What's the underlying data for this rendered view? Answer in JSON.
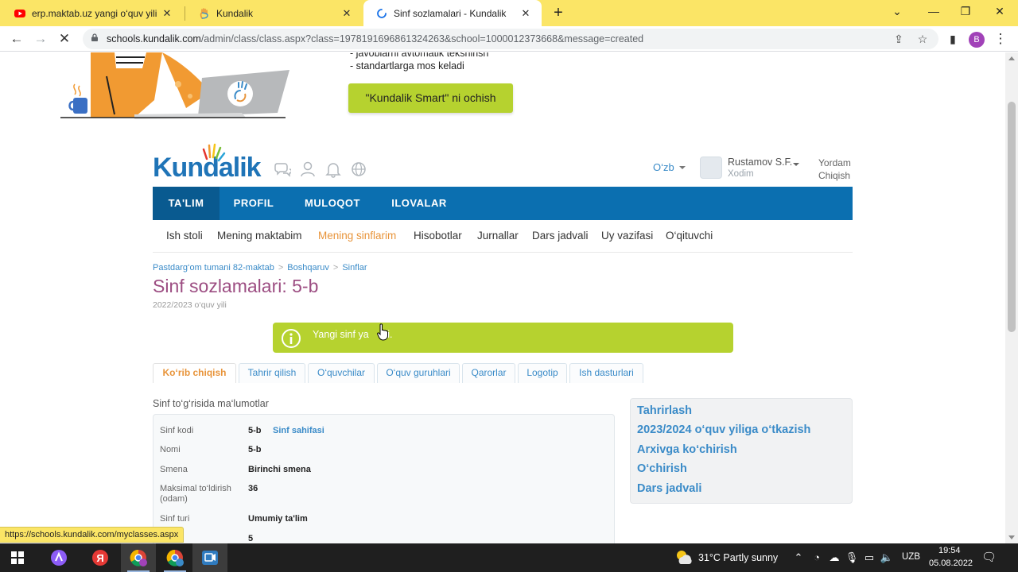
{
  "browser": {
    "tabs": [
      {
        "title": "erp.maktab.uz yangi o‘quv yili o‘t",
        "icon": "youtube-icon"
      },
      {
        "title": "Kundalik",
        "icon": "kundalik-hand-icon"
      },
      {
        "title": "Sinf sozlamalari - Kundalik",
        "icon": "loading-spinner-icon"
      }
    ],
    "url_host": "schools.kundalik.com",
    "url_rest": "/admin/class/class.aspx?class=1978191696861324263&school=1000012373668&message=created",
    "profile_initial": "B",
    "status_url": "https://schools.kundalik.com/myclasses.aspx"
  },
  "banner": {
    "lines": [
      "- javoblarni avtomatik tekshirish",
      "- standartlarga mos keladi"
    ],
    "button": "\"Kundalik Smart\" ni ochish"
  },
  "header": {
    "language": "O‘zb",
    "user_name": "Rustamov S.F.",
    "user_role": "Xodim",
    "help": "Yordam",
    "logout": "Chiqish"
  },
  "main_nav": [
    "TA'LIM",
    "PROFIL",
    "MULOQOT",
    "ILOVALAR"
  ],
  "sub_nav": [
    "Ish stoli",
    "Mening maktabim",
    "Mening sinflarim",
    "Hisobotlar",
    "Jurnallar",
    "Dars jadvali",
    "Uy vazifasi",
    "O‘qituvchi"
  ],
  "breadcrumbs": [
    "Pastdarg‘om tumani 82-maktab",
    "Boshqaruv",
    "Sinflar"
  ],
  "page": {
    "title": "Sinf sozlamalari: 5-b",
    "subtitle": "2022/2023 o‘quv yili",
    "alert": "Yangi sinf yaratildi.",
    "alert_visible": "Yangi sinf ya    ldi."
  },
  "content_tabs": [
    "Ko‘rib chiqish",
    "Tahrir qilish",
    "O‘quvchilar",
    "O‘quv guruhlari",
    "Qarorlar",
    "Logotip",
    "Ish dasturlari"
  ],
  "info": {
    "section_label": "Sinf to‘g‘risida ma‘lumotlar",
    "rows": [
      {
        "label": "Sinf kodi",
        "value": "5-b",
        "link": "Sinf sahifasi"
      },
      {
        "label": "Nomi",
        "value": "5-b"
      },
      {
        "label": "Smena",
        "value": "Birinchi smena"
      },
      {
        "label": "Maksimal to‘ldirish (odam)",
        "value": "36"
      },
      {
        "label": "Sinf turi",
        "value": "Umumiy ta'lim"
      },
      {
        "label": "el",
        "value": "5"
      }
    ]
  },
  "side_actions": [
    "Tahrirlash",
    "2023/2024 o‘quv yiliga o‘tkazish",
    "Arxivga ko‘chirish",
    "O‘chirish",
    "Dars jadvali"
  ],
  "taskbar": {
    "weather": "31°C  Partly sunny",
    "keyboard": "UZB",
    "time": "19:54",
    "date": "05.08.2022"
  },
  "colors": {
    "nav_blue": "#0b6fb0",
    "accent_green": "#b6d22f",
    "link_blue": "#3a8bc8",
    "active_orange": "#e8943a",
    "title_purple": "#9c4d82",
    "chrome_yellow": "#fbe566"
  }
}
